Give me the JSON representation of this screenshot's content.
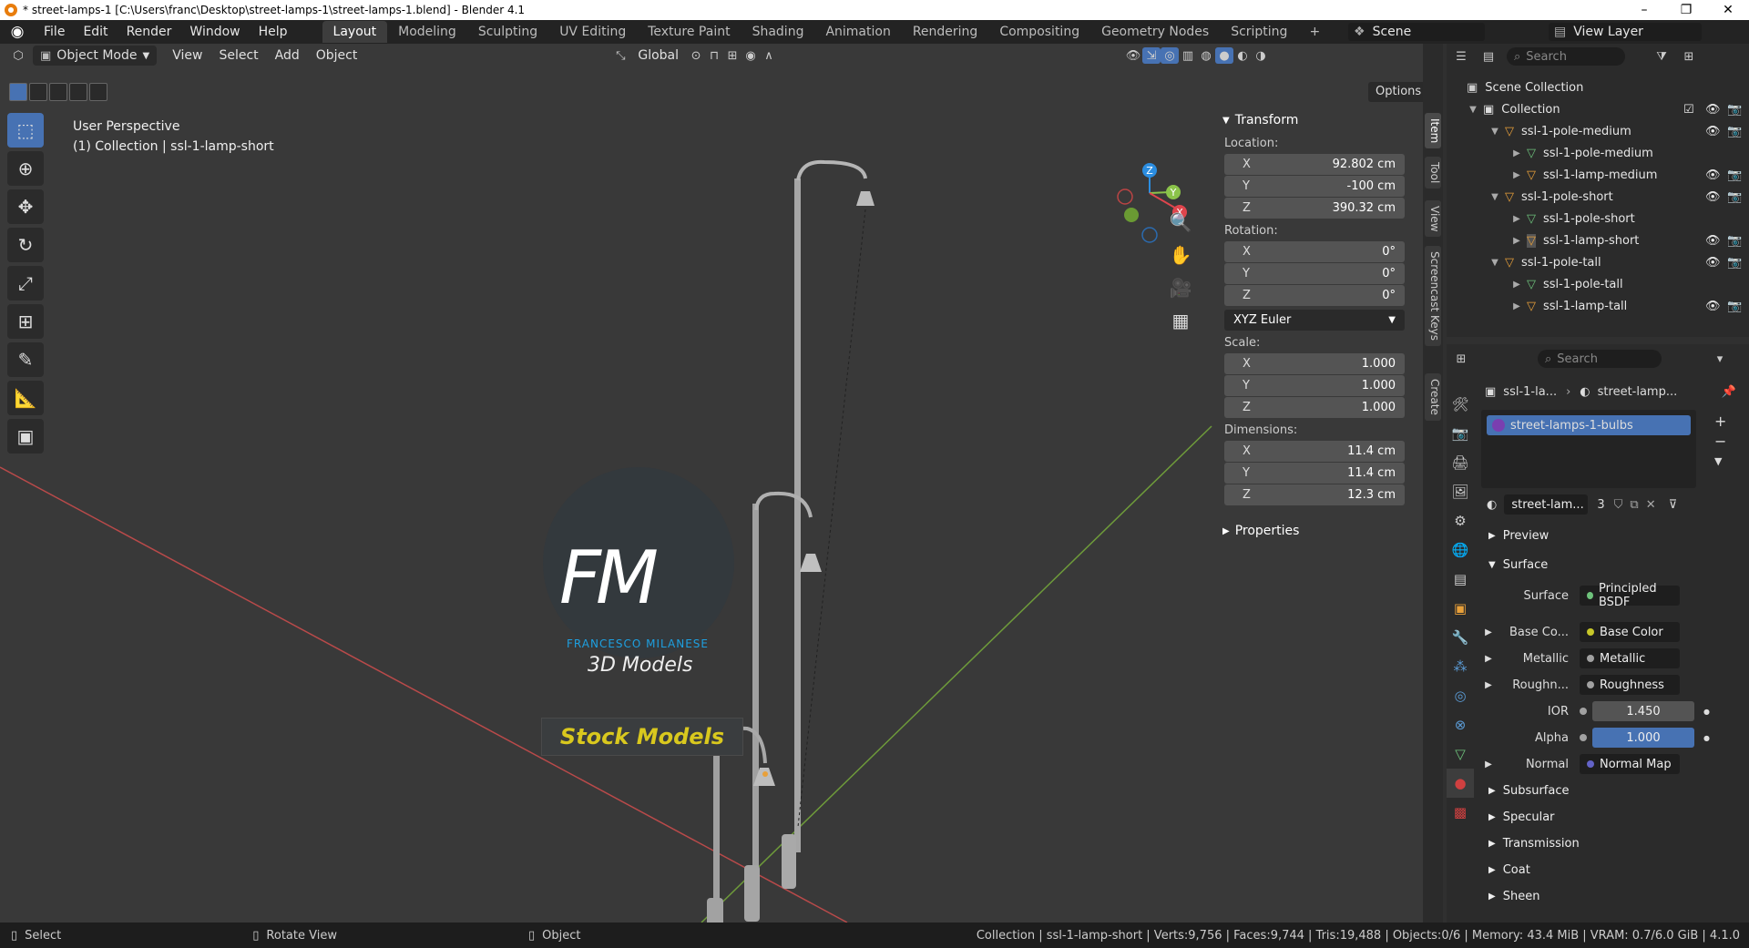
{
  "window": {
    "title": "* street-lamps-1 [C:\\Users\\franc\\Desktop\\street-lamps-1\\street-lamps-1.blend] - Blender 4.1",
    "minimize": "–",
    "maximize": "❐",
    "close": "✕"
  },
  "menu": [
    "File",
    "Edit",
    "Render",
    "Window",
    "Help"
  ],
  "workspaces": [
    "Layout",
    "Modeling",
    "Sculpting",
    "UV Editing",
    "Texture Paint",
    "Shading",
    "Animation",
    "Rendering",
    "Compositing",
    "Geometry Nodes",
    "Scripting"
  ],
  "active_workspace": "Layout",
  "scene_name": "Scene",
  "view_layer": "View Layer",
  "viewport_header": {
    "mode": "Object Mode",
    "items": [
      "View",
      "Select",
      "Add",
      "Object"
    ],
    "orientation": "Global",
    "options": "Options"
  },
  "viewport_info": {
    "perspective": "User Perspective",
    "collection": "(1) Collection | ssl-1-lamp-short"
  },
  "gizmo_labels": {
    "x": "X",
    "y": "Y",
    "z": "Z"
  },
  "watermark": {
    "logo_text": "FM",
    "name": "FRANCESCO MILANESE",
    "subtitle": "3D Models",
    "stock": "Stock Models"
  },
  "npanel": {
    "transform_title": "Transform",
    "location_label": "Location:",
    "location": [
      {
        "axis": "X",
        "value": "92.802 cm"
      },
      {
        "axis": "Y",
        "value": "-100 cm"
      },
      {
        "axis": "Z",
        "value": "390.32 cm"
      }
    ],
    "rotation_label": "Rotation:",
    "rotation": [
      {
        "axis": "X",
        "value": "0°"
      },
      {
        "axis": "Y",
        "value": "0°"
      },
      {
        "axis": "Z",
        "value": "0°"
      }
    ],
    "rotation_mode": "XYZ Euler",
    "scale_label": "Scale:",
    "scale": [
      {
        "axis": "X",
        "value": "1.000"
      },
      {
        "axis": "Y",
        "value": "1.000"
      },
      {
        "axis": "Z",
        "value": "1.000"
      }
    ],
    "dimensions_label": "Dimensions:",
    "dimensions": [
      {
        "axis": "X",
        "value": "11.4 cm"
      },
      {
        "axis": "Y",
        "value": "11.4 cm"
      },
      {
        "axis": "Z",
        "value": "12.3 cm"
      }
    ],
    "properties_title": "Properties"
  },
  "side_tabs": [
    "Item",
    "Tool",
    "View",
    "Screencast Keys",
    "Create"
  ],
  "outliner": {
    "search_placeholder": "Search",
    "rows": [
      {
        "label": "Scene Collection",
        "indent": 0
      },
      {
        "label": "Collection",
        "indent": 1
      },
      {
        "label": "ssl-1-pole-medium",
        "indent": 2
      },
      {
        "label": "ssl-1-pole-medium",
        "indent": 3
      },
      {
        "label": "ssl-1-lamp-medium",
        "indent": 3
      },
      {
        "label": "ssl-1-pole-short",
        "indent": 2
      },
      {
        "label": "ssl-1-pole-short",
        "indent": 3
      },
      {
        "label": "ssl-1-lamp-short",
        "indent": 3
      },
      {
        "label": "ssl-1-pole-tall",
        "indent": 2
      },
      {
        "label": "ssl-1-pole-tall",
        "indent": 3
      },
      {
        "label": "ssl-1-lamp-tall",
        "indent": 3
      }
    ]
  },
  "properties": {
    "search_placeholder": "Search",
    "breadcrumb_object": "ssl-1-la...",
    "breadcrumb_material": "street-lamp...",
    "material_slot": "street-lamps-1-bulbs",
    "material_name": "street-lam...",
    "user_count": "3",
    "preview": "Preview",
    "surface_section": "Surface",
    "surface_label": "Surface",
    "surface_value": "Principled BSDF",
    "inputs": [
      {
        "label": "Base Co...",
        "value": "Base Color"
      },
      {
        "label": "Metallic",
        "value": "Metallic"
      },
      {
        "label": "Roughn...",
        "value": "Roughness"
      },
      {
        "label": "IOR",
        "value": "1.450"
      },
      {
        "label": "Alpha",
        "value": "1.000"
      },
      {
        "label": "Normal",
        "value": "Normal Map"
      }
    ],
    "sections": [
      "Subsurface",
      "Specular",
      "Transmission",
      "Coat",
      "Sheen"
    ]
  },
  "statusbar": {
    "select": "Select",
    "rotate": "Rotate View",
    "object": "Object",
    "stats": "Collection | ssl-1-lamp-short | Verts:9,756 | Faces:9,744 | Tris:19,488 | Objects:0/6 | Memory: 43.4 MiB | VRAM: 0.7/6.0 GiB | 4.1.0"
  },
  "colors": {
    "accent": "#4772b3",
    "x_axis": "#e0454d",
    "y_axis": "#8bc34a",
    "z_axis": "#2b8de0",
    "stock_text": "#d9c81e",
    "brand_blue": "#1ea0e0"
  }
}
